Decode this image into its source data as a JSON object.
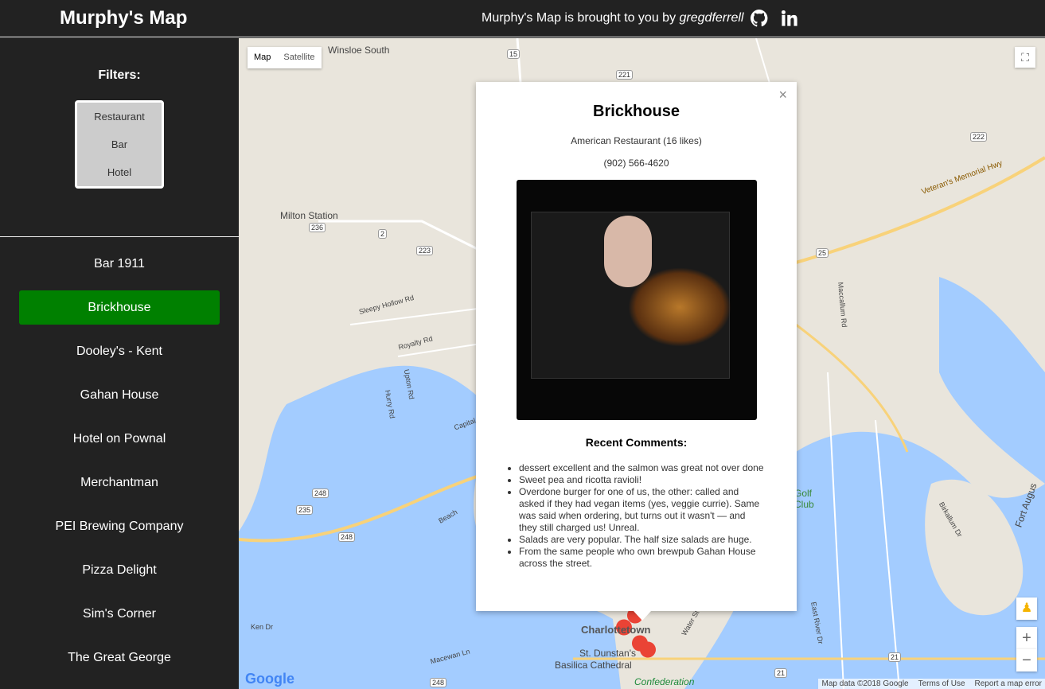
{
  "header": {
    "title": "Murphy's Map",
    "credit_prefix": "Murphy's Map is brought to you by ",
    "credit_author": "gregdferrell",
    "icons": [
      "github-icon",
      "linkedin-icon"
    ]
  },
  "sidebar": {
    "filters_label": "Filters:",
    "filter_options": [
      "Restaurant",
      "Bar",
      "Hotel"
    ],
    "places": [
      "Bar 1911",
      "Brickhouse",
      "Dooley's - Kent",
      "Gahan House",
      "Hotel on Pownal",
      "Merchantman",
      "PEI Brewing Company",
      "Pizza Delight",
      "Sim's Corner",
      "The Great George"
    ],
    "selected": "Brickhouse",
    "accent": "#008000"
  },
  "map": {
    "type_buttons": [
      "Map",
      "Satellite"
    ],
    "labels": [
      "Winsloe South",
      "Milton Station",
      "Sleepy Hollow Rd",
      "Royalty Rd",
      "Upton Rd",
      "Hurry Rd",
      "Capital",
      "Veteran's Memorial Hwy",
      "Maccallum Rd",
      "Golf Club",
      "Birkallum Dr",
      "Fort Augus",
      "Charlottetown",
      "St. Dunstan's",
      "Basilica Cathedral",
      "Confederation",
      "Ken Dr",
      "Macewan Ln",
      "East River Dr",
      "Water St",
      "Beach"
    ],
    "shields": [
      "15",
      "221",
      "222",
      "236",
      "2",
      "223",
      "25",
      "248",
      "235",
      "248",
      "248",
      "21",
      "21"
    ],
    "logo": "Google",
    "attribution": [
      "Map data ©2018 Google",
      "Terms of Use",
      "Report a map error"
    ],
    "zoom_in": "+",
    "zoom_out": "−"
  },
  "infowindow": {
    "name": "Brickhouse",
    "category": "American Restaurant (16 likes)",
    "phone": "(902) 566-4620",
    "comments_title": "Recent Comments:",
    "comments": [
      "dessert excellent and the salmon was great not over done",
      "Sweet pea and ricotta ravioli!",
      "Overdone burger for one of us, the other: called and asked if they had vegan items (yes, veggie currie). Same was said when ordering, but turns out it wasn't — and they still charged us! Unreal.",
      "Salads are very popular. The half size salads are huge.",
      "From the same people who own brewpub Gahan House across the street."
    ],
    "close": "×"
  }
}
